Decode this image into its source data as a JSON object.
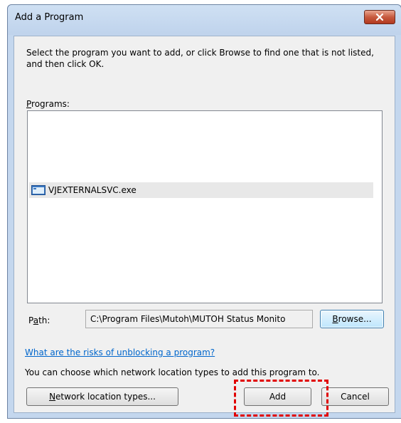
{
  "dialog": {
    "title": "Add a Program",
    "intro": "Select the program you want to add, or click Browse to find one that is not listed, and then click OK.",
    "programs_label": "Programs:",
    "programs": [
      "VJEXTERNALSVC.exe"
    ],
    "path_label": "Path:",
    "path_value": "C:\\Program Files\\Mutoh\\MUTOH Status Monito",
    "browse_label": "Browse...",
    "risk_link": "What are the risks of unblocking a program?",
    "network_hint": "You can choose which network location types to add this program to.",
    "network_button": "Network location types...",
    "add_button": "Add",
    "cancel_button": "Cancel"
  },
  "annotation": {
    "color": "#e00000",
    "target": "Add"
  }
}
